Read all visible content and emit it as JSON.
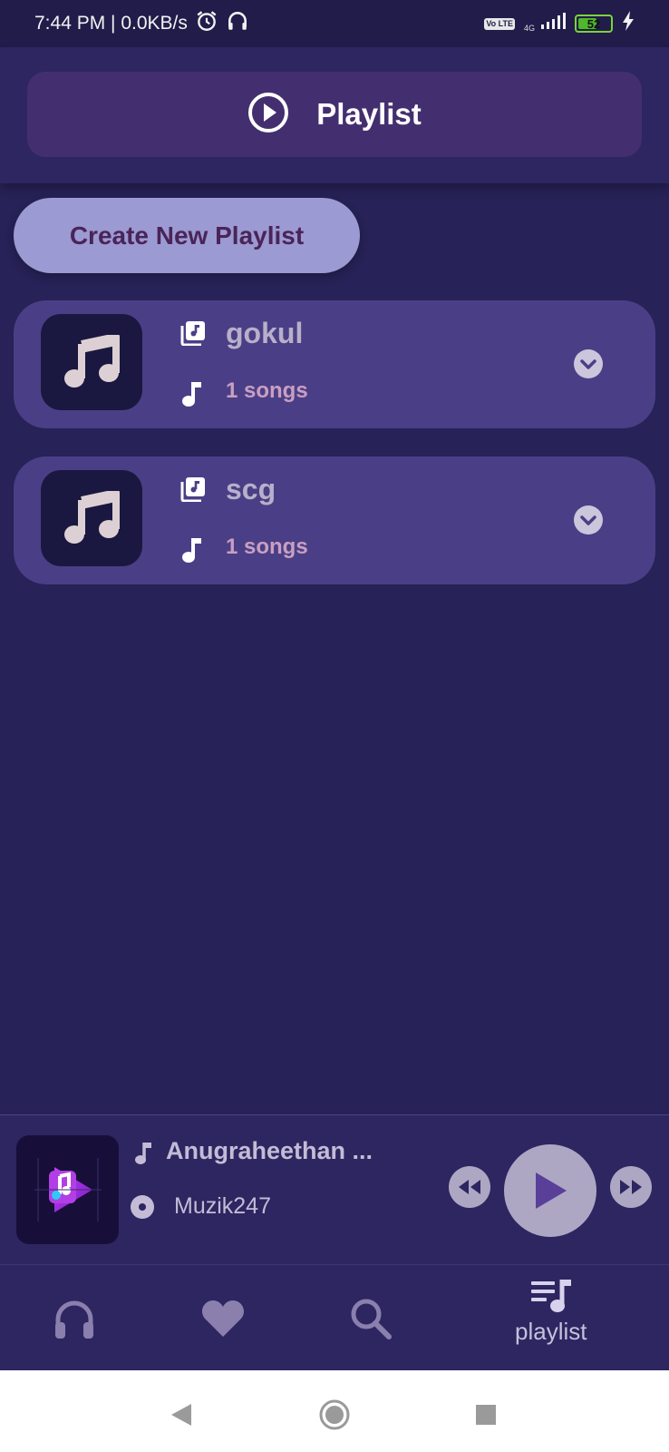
{
  "status_bar": {
    "time_speed": "7:44 PM | 0.0KB/s",
    "volte": "Vo LTE",
    "network": "4G",
    "battery": "52"
  },
  "header": {
    "title": "Playlist"
  },
  "create_button": {
    "label": "Create New Playlist"
  },
  "playlists": [
    {
      "name": "gokul",
      "count": "1 songs"
    },
    {
      "name": "scg",
      "count": "1 songs"
    }
  ],
  "player": {
    "title": "Anugraheethan ...",
    "artist": "Muzik247"
  },
  "bottom_nav": {
    "items": [
      {
        "icon": "headphones-icon",
        "label": ""
      },
      {
        "icon": "heart-icon",
        "label": ""
      },
      {
        "icon": "search-icon",
        "label": ""
      },
      {
        "icon": "playlist-icon",
        "label": "playlist"
      }
    ]
  },
  "colors": {
    "background": "#272257",
    "card": "#4a3f86",
    "accent_button": "#9b9ad2",
    "header_box": "#432f6f"
  }
}
